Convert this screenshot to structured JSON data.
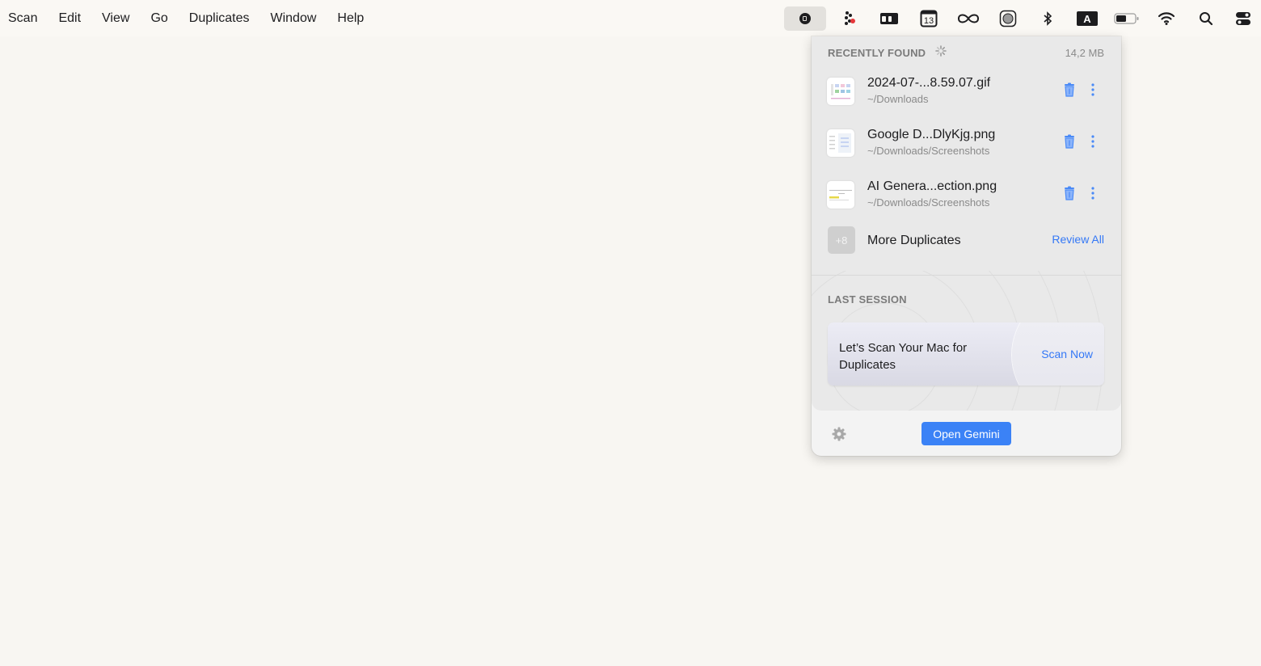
{
  "menubar": {
    "app_menus": [
      "Scan",
      "Edit",
      "View",
      "Go",
      "Duplicates",
      "Window",
      "Help"
    ],
    "tray_icons": [
      {
        "name": "gemini-tray-icon",
        "active": true
      },
      {
        "name": "dots-app-icon",
        "active": false
      },
      {
        "name": "wallet-icon",
        "active": false
      },
      {
        "name": "calendar-icon",
        "date": "13",
        "active": false
      },
      {
        "name": "infinity-icon",
        "active": false
      },
      {
        "name": "record-icon",
        "active": false
      },
      {
        "name": "bluetooth-icon",
        "active": false
      },
      {
        "name": "input-source-icon",
        "letter": "A",
        "active": false
      },
      {
        "name": "battery-icon",
        "active": false
      },
      {
        "name": "wifi-icon",
        "active": false
      },
      {
        "name": "spotlight-search-icon",
        "active": false
      },
      {
        "name": "control-center-icon",
        "active": false
      }
    ]
  },
  "popover": {
    "recently_found": {
      "heading": "RECENTLY FOUND",
      "total_size": "14,2 MB",
      "files": [
        {
          "name": "2024-07-...8.59.07.gif",
          "path": "~/Downloads"
        },
        {
          "name": "Google D...DlyKjg.png",
          "path": "~/Downloads/Screenshots"
        },
        {
          "name": "AI Genera...ection.png",
          "path": "~/Downloads/Screenshots"
        }
      ],
      "more": {
        "badge": "+8",
        "label": "More Duplicates",
        "action": "Review All"
      }
    },
    "last_session": {
      "heading": "LAST SESSION",
      "card_text": "Let’s Scan Your Mac for Duplicates",
      "action": "Scan Now"
    },
    "footer": {
      "open_button": "Open Gemini"
    }
  },
  "colors": {
    "accent": "#3478f6",
    "button": "#3b82f6",
    "desktop": "#f8f6f2"
  }
}
